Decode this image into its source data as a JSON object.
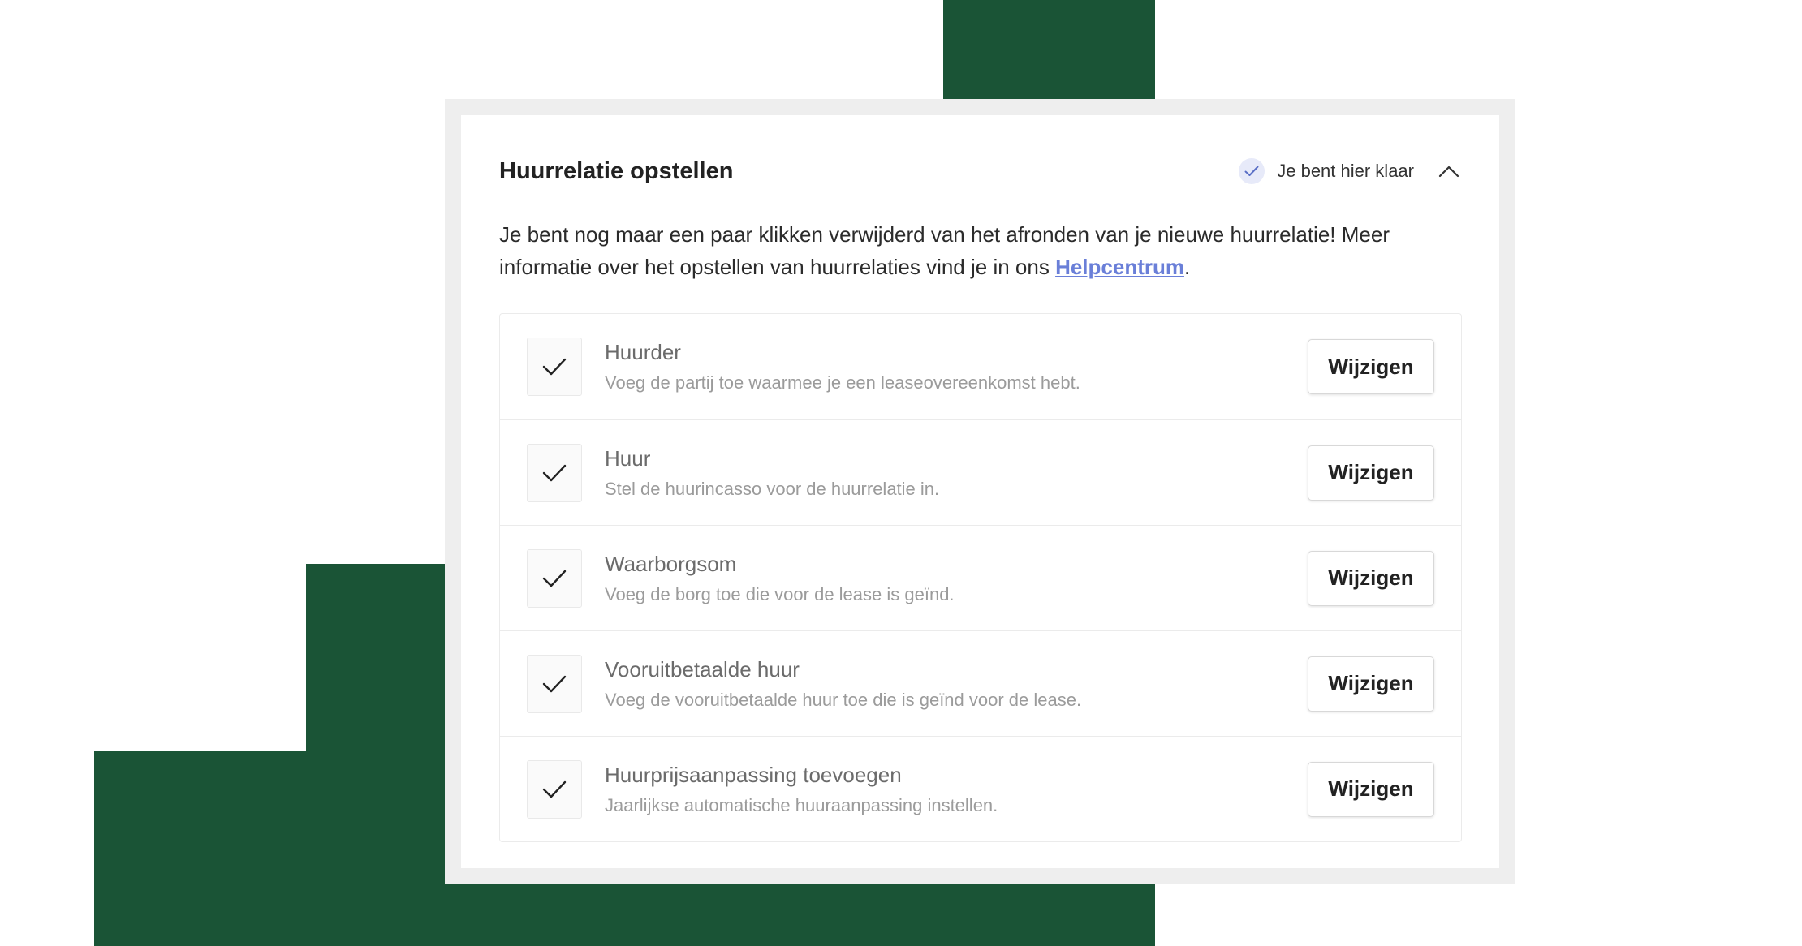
{
  "colors": {
    "deco_green": "#1a5436",
    "link": "#6a7fd8",
    "frame_border": "#eeeeee",
    "done_badge_bg": "#e7eaf9",
    "done_check": "#5a6fc6"
  },
  "card": {
    "title": "Huurrelatie opstellen",
    "status_icon": "check-icon",
    "status_text": "Je bent hier klaar",
    "collapse_icon": "chevron-up-icon"
  },
  "intro": {
    "text_before": "Je bent nog maar een paar klikken verwijderd van het afronden van je nieuwe huurrelatie! Meer informatie over het opstellen van huurrelaties vind je in ons ",
    "link_text": "Helpcentrum",
    "text_after": "."
  },
  "steps": [
    {
      "title": "Huurder",
      "description": "Voeg de partij toe waarmee je een leaseovereenkomst hebt.",
      "button_label": "Wijzigen",
      "completed": true
    },
    {
      "title": "Huur",
      "description": "Stel de huurincasso voor de huurrelatie in.",
      "button_label": "Wijzigen",
      "completed": true
    },
    {
      "title": "Waarborgsom",
      "description": "Voeg de borg toe die voor de lease is geïnd.",
      "button_label": "Wijzigen",
      "completed": true
    },
    {
      "title": "Vooruitbetaalde huur",
      "description": "Voeg de vooruitbetaalde huur toe die is geïnd voor de lease.",
      "button_label": "Wijzigen",
      "completed": true
    },
    {
      "title": "Huurprijsaanpassing toevoegen",
      "description": "Jaarlijkse automatische huuraanpassing instellen.",
      "button_label": "Wijzigen",
      "completed": true
    }
  ]
}
